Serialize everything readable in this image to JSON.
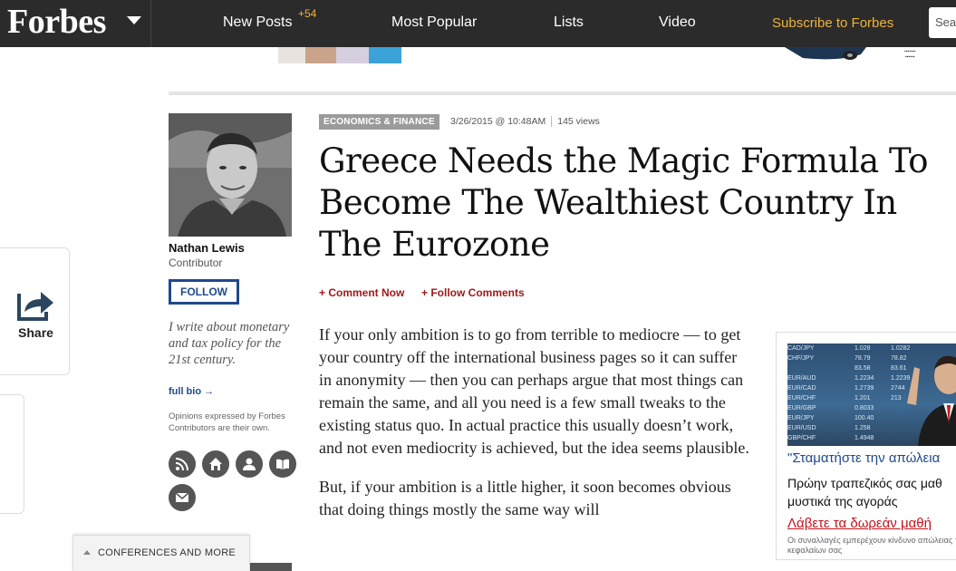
{
  "nav": {
    "logo": "Forbes",
    "items": [
      {
        "label": "New Posts",
        "badge": "+54"
      },
      {
        "label": "Most Popular"
      },
      {
        "label": "Lists"
      },
      {
        "label": "Video"
      }
    ],
    "subscribe": "Subscribe to Forbes",
    "search_placeholder": "Search",
    "accent_color": "#f0b437"
  },
  "share": {
    "label": "Share"
  },
  "author": {
    "name": "Nathan Lewis",
    "role": "Contributor",
    "follow_label": "FOLLOW",
    "bio": "I write about monetary and tax policy for the 21st century.",
    "full_bio_label": "full bio →",
    "opinion_note": "Opinions expressed by Forbes Contributors are their own.",
    "social_icons": [
      "rss-icon",
      "home-icon",
      "profile-icon",
      "book-icon",
      "email-icon"
    ]
  },
  "article": {
    "section": "ECONOMICS & FINANCE",
    "date": "3/26/2015 @ 10:48AM",
    "views": "145 views",
    "title": "Greece Needs the Magic Formula To Become The Wealthiest Country In The Eurozone",
    "comment_now": "+ Comment Now",
    "follow_comments": "+ Follow Comments",
    "paragraphs": [
      "If your only ambition is to go from terrible to mediocre — to get your country off the international business pages so it can suffer in anonymity — then you can perhaps argue that most things can remain the same, and all you need is a few small tweaks to the existing status quo. In actual practice this usually doesn’t work, and not even mediocrity is achieved, but the idea seems plausible.",
      "But, if your ambition is a little higher, it soon becomes obvious that doing things mostly the same way will"
    ]
  },
  "ad": {
    "ticker": [
      {
        "pair": "CAD/JPY",
        "a": "1.028",
        "b": "1.0282"
      },
      {
        "pair": "CHF/JPY",
        "a": "78.79",
        "b": "78.82"
      },
      {
        "pair": "",
        "a": "83.58",
        "b": "83.61"
      },
      {
        "pair": "EUR/AUD",
        "a": "1.2234",
        "b": "1.2239"
      },
      {
        "pair": "EUR/CAD",
        "a": "1.2739",
        "b": "2744"
      },
      {
        "pair": "EUR/CHF",
        "a": "1.201",
        "b": "213"
      },
      {
        "pair": "EUR/GBP",
        "a": "0.8033",
        "b": ""
      },
      {
        "pair": "EUR/JPY",
        "a": "100.40",
        "b": ""
      },
      {
        "pair": "EUR/USD",
        "a": "1.258",
        "b": ""
      },
      {
        "pair": "GBP/CHF",
        "a": "1.4948",
        "b": ""
      }
    ],
    "headline": "\"Σταματήστε την απώλεια",
    "line1": "Πρώην τραπεζικός σας μαθ",
    "line2": "μυστικά της αγοράς",
    "cta": "Λάβετε τα δωρεάν μαθή",
    "disclaimer": "Οι συναλλαγές εμπερέχουν κίνδυνο απώλειας των κεφαλαίων σας"
  },
  "footer": {
    "conferences_label": "CONFERENCES AND MORE"
  }
}
